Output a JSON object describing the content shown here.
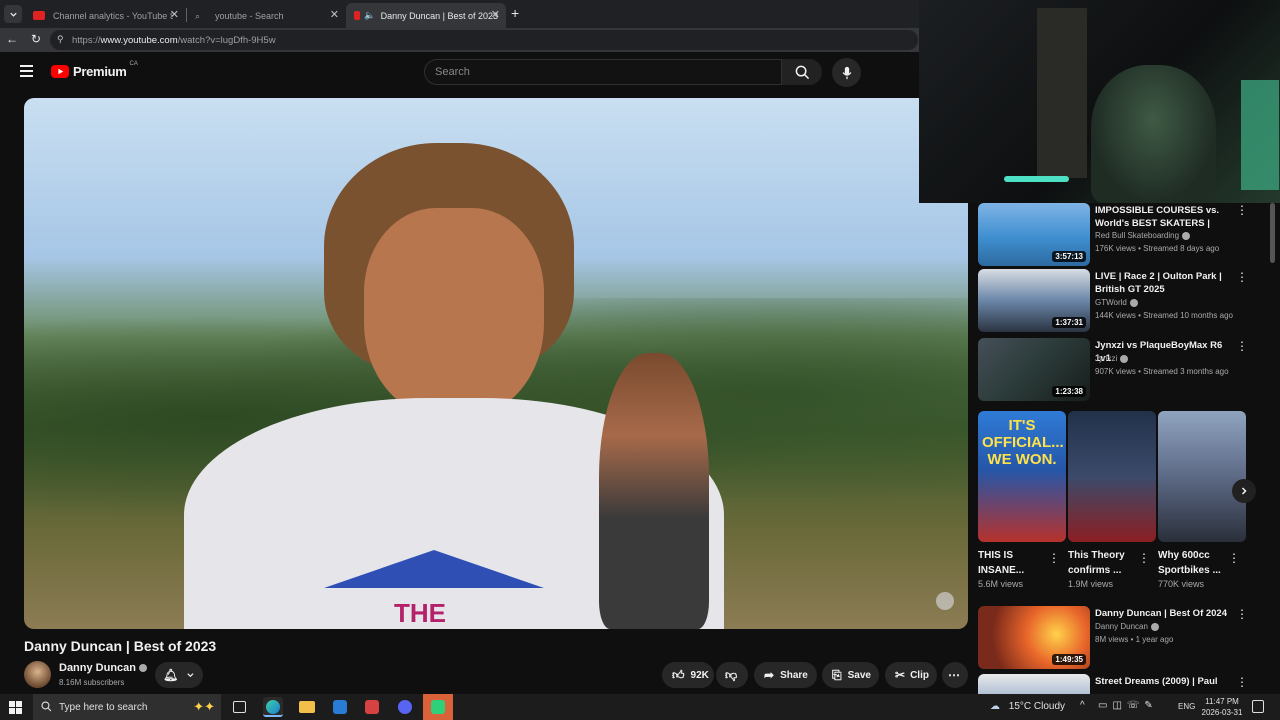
{
  "browser": {
    "tabs": [
      {
        "label": "Channel analytics - YouTube Studi",
        "active": false
      },
      {
        "label": "youtube - Search",
        "active": false
      },
      {
        "label": "Danny Duncan | Best of 2023",
        "active": true
      }
    ],
    "url_prefix": "https://",
    "url_host": "www.youtube.com",
    "url_path": "/watch?v=lugDfh-9H5w"
  },
  "youtube": {
    "logo_text": "Premium",
    "region": "CA",
    "search_placeholder": "Search"
  },
  "video": {
    "title": "Danny Duncan | Best of 2023",
    "channel": "Danny Duncan",
    "subscribers": "8.16M subscribers",
    "likes": "92K",
    "share_label": "Share",
    "save_label": "Save",
    "clip_label": "Clip",
    "shirt_text": "THE"
  },
  "sidebar": {
    "recs": [
      {
        "title": "IMPOSSIBLE COURSES vs. World's BEST SKATERS | KASS...",
        "channel": "Red Bull Skateboarding",
        "meta": "176K views • Streamed 8 days ago",
        "duration": "3:57:13",
        "color": "#3f8fd0"
      },
      {
        "title": "LIVE | Race 2 | Oulton Park | British GT 2025",
        "channel": "GTWorld",
        "meta": "144K views • Streamed 10 months ago",
        "duration": "1:37:31",
        "color": "#6b86a8"
      },
      {
        "title": "Jynxzi vs PlaqueBoyMax R6 1v1",
        "channel": "Jynxzi",
        "meta": "907K views • Streamed 3 months ago",
        "duration": "1:23:38",
        "color": "#2a3a38"
      }
    ],
    "shorts": [
      {
        "title": "THIS IS INSANE...",
        "views": "5.6M views",
        "overlay": "IT'S OFFICIAL... WE WON.",
        "color": "#2f7bd6"
      },
      {
        "title": "This Theory confirms ...",
        "views": "1.9M views",
        "overlay": "",
        "color": "#3b4a6a"
      },
      {
        "title": "Why 600cc Sportbikes ...",
        "views": "770K views",
        "overlay": "",
        "color": "#5d6a86"
      }
    ],
    "recs2": [
      {
        "title": "Danny Duncan | Best Of 2024",
        "channel": "Danny Duncan",
        "meta": "8M views • 1 year ago",
        "duration": "1:49:35",
        "color": "#d8732e"
      },
      {
        "title": "Street Dreams (2009) | Paul",
        "channel": "",
        "meta": "",
        "duration": "",
        "color": "#3b6fb0"
      }
    ]
  },
  "taskbar": {
    "search_placeholder": "Type here to search",
    "weather": "15°C  Cloudy",
    "language": "ENG",
    "time": "11:47 PM",
    "date": "2026-03-31"
  }
}
